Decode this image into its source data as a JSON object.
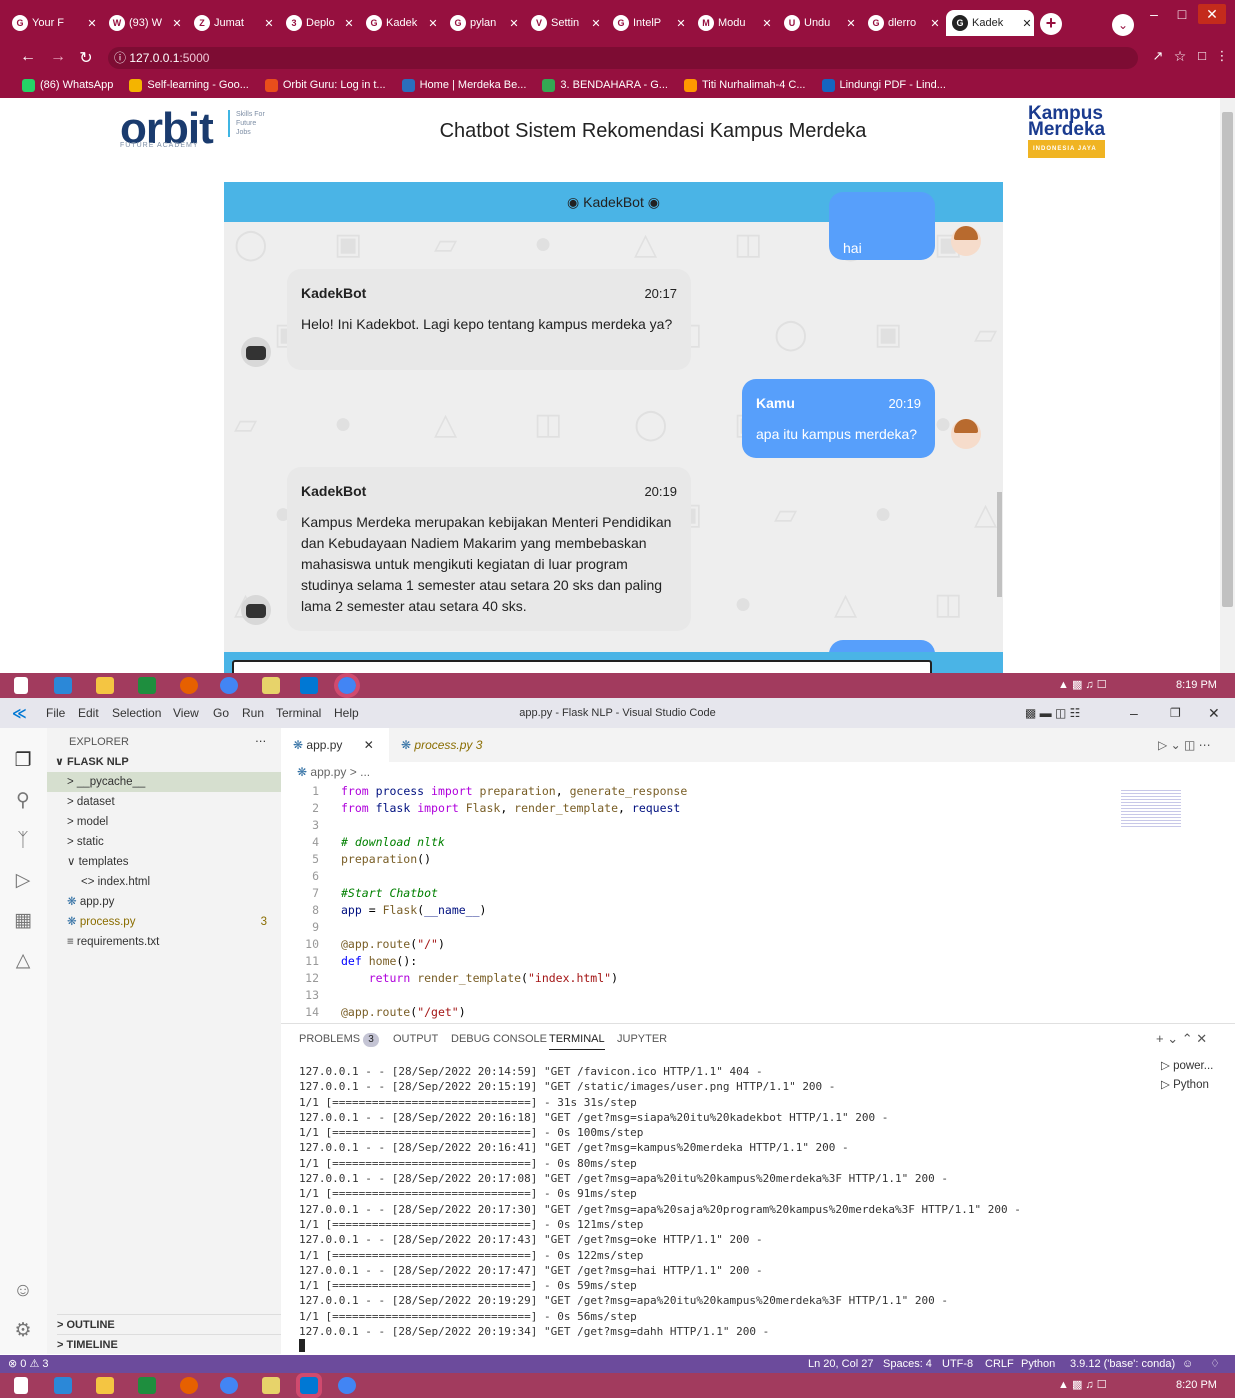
{
  "browser": {
    "tabs": [
      {
        "label": "Your F",
        "icon": "G"
      },
      {
        "label": "(93) W",
        "icon": "W"
      },
      {
        "label": "Jumat",
        "icon": "Z"
      },
      {
        "label": "Deplo",
        "icon": "3"
      },
      {
        "label": "Kadek",
        "icon": "G"
      },
      {
        "label": "pylan",
        "icon": "G"
      },
      {
        "label": "Settin",
        "icon": "V"
      },
      {
        "label": "IntelP",
        "icon": "G"
      },
      {
        "label": "Modu",
        "icon": "M"
      },
      {
        "label": "Undu",
        "icon": "U"
      },
      {
        "label": "dlerro",
        "icon": "G"
      },
      {
        "label": "Kadek",
        "icon": "G",
        "active": true
      }
    ],
    "url_host": "127.0.0.1",
    "url_port": ":5000",
    "bookmarks": [
      {
        "label": "(86) WhatsApp",
        "color": "#25d366"
      },
      {
        "label": "Self-learning - Goo...",
        "color": "#f4b400"
      },
      {
        "label": "Orbit Guru: Log in t...",
        "color": "#e94e1b"
      },
      {
        "label": "Home | Merdeka Be...",
        "color": "#2a6ebd"
      },
      {
        "label": "3. BENDAHARA - G...",
        "color": "#34a853"
      },
      {
        "label": "Titi Nurhalimah-4 C...",
        "color": "#ff9800"
      },
      {
        "label": "Lindungi PDF - Lind...",
        "color": "#1565c0"
      }
    ]
  },
  "page": {
    "orbit_logo": "orbit",
    "orbit_sub": "FUTURE ACADEMY",
    "orbit_tag": "Skills For Future Jobs",
    "title": "Chatbot Sistem Rekomendasi Kampus Merdeka",
    "km_logo_line1": "Kampus",
    "km_logo_line2": "Merdeka",
    "km_logo_band": "INDONESIA JAYA",
    "chat_header": "KadekBot",
    "messages": [
      {
        "from": "user",
        "name": "",
        "time": "",
        "text": "hai"
      },
      {
        "from": "bot",
        "name": "KadekBot",
        "time": "20:17",
        "text": "Helo! Ini Kadekbot. Lagi kepo tentang kampus merdeka ya?"
      },
      {
        "from": "user",
        "name": "Kamu",
        "time": "20:19",
        "text": "apa itu kampus merdeka?"
      },
      {
        "from": "bot",
        "name": "KadekBot",
        "time": "20:19",
        "text": "Kampus Merdeka merupakan kebijakan Menteri Pendidikan dan Kebudayaan Nadiem Makarim yang membebaskan mahasiswa untuk mengikuti kegiatan di luar program studinya selama 1 semester atau setara 20 sks dan paling lama 2 semester atau setara 40 sks."
      }
    ]
  },
  "taskbar_top": {
    "time": "8:19 PM"
  },
  "taskbar_bottom": {
    "time": "8:20 PM"
  },
  "vscode": {
    "menu": [
      "File",
      "Edit",
      "Selection",
      "View",
      "Go",
      "Run",
      "Terminal",
      "Help"
    ],
    "window_title": "app.py - Flask NLP - Visual Studio Code",
    "explorer_title": "EXPLORER",
    "project": "FLASK NLP",
    "tree": [
      {
        "label": "> __pycache__",
        "indent": 1,
        "selected": true
      },
      {
        "label": "> dataset",
        "indent": 1
      },
      {
        "label": "> model",
        "indent": 1
      },
      {
        "label": "> static",
        "indent": 1
      },
      {
        "label": "∨ templates",
        "indent": 1
      },
      {
        "label": "<> index.html",
        "indent": 2
      },
      {
        "label": "app.py",
        "indent": 1,
        "py": true
      },
      {
        "label": "process.py",
        "indent": 1,
        "py": true,
        "badge": "3"
      },
      {
        "label": "≡ requirements.txt",
        "indent": 1
      }
    ],
    "outline": "> OUTLINE",
    "timeline": "> TIMELINE",
    "tab_active": "app.py",
    "tab_other": "process.py 3",
    "breadcrumb": "app.py > ...",
    "code": [
      {
        "n": "1",
        "html": "<span class='kw2'>from</span> <span class='vr'>process</span> <span class='kw2'>import</span> <span class='fn'>preparation</span>, <span class='fn'>generate_response</span>"
      },
      {
        "n": "2",
        "html": "<span class='kw2'>from</span> <span class='vr'>flask</span> <span class='kw2'>import</span> <span class='fn'>Flask</span>, <span class='fn'>render_template</span>, <span class='vr'>request</span>"
      },
      {
        "n": "3",
        "html": ""
      },
      {
        "n": "4",
        "html": "<span class='cm'># download nltk</span>"
      },
      {
        "n": "5",
        "html": "<span class='fn'>preparation</span>()"
      },
      {
        "n": "6",
        "html": ""
      },
      {
        "n": "7",
        "html": "<span class='cm'>#Start Chatbot</span>"
      },
      {
        "n": "8",
        "html": "<span class='vr'>app</span> = <span class='fn'>Flask</span>(<span class='vr'>__name__</span>)"
      },
      {
        "n": "9",
        "html": ""
      },
      {
        "n": "10",
        "html": "<span class='dc'>@app.route</span>(<span class='st'>\"/\"</span>)"
      },
      {
        "n": "11",
        "html": "<span class='kw'>def</span> <span class='fn'>home</span>():"
      },
      {
        "n": "12",
        "html": "    <span class='kw2'>return</span> <span class='fn'>render_template</span>(<span class='st'>\"index.html\"</span>)"
      },
      {
        "n": "13",
        "html": ""
      },
      {
        "n": "14",
        "html": "<span class='dc'>@app.route</span>(<span class='st'>\"/get\"</span>)"
      }
    ],
    "panel_tabs": [
      "PROBLEMS",
      "OUTPUT",
      "DEBUG CONSOLE",
      "TERMINAL",
      "JUPYTER"
    ],
    "problems_count": "3",
    "terminals": [
      "power...",
      "Python"
    ],
    "terminal_lines": [
      "127.0.0.1 - - [28/Sep/2022 20:14:59] \"GET /favicon.ico HTTP/1.1\" 404 -",
      "127.0.0.1 - - [28/Sep/2022 20:15:19] \"GET /static/images/user.png HTTP/1.1\" 200 -",
      "1/1 [==============================] - 31s 31s/step",
      "127.0.0.1 - - [28/Sep/2022 20:16:18] \"GET /get?msg=siapa%20itu%20kadekbot HTTP/1.1\" 200 -",
      "1/1 [==============================] - 0s 100ms/step",
      "127.0.0.1 - - [28/Sep/2022 20:16:41] \"GET /get?msg=kampus%20merdeka HTTP/1.1\" 200 -",
      "1/1 [==============================] - 0s 80ms/step",
      "127.0.0.1 - - [28/Sep/2022 20:17:08] \"GET /get?msg=apa%20itu%20kampus%20merdeka%3F HTTP/1.1\" 200 -",
      "1/1 [==============================] - 0s 91ms/step",
      "127.0.0.1 - - [28/Sep/2022 20:17:30] \"GET /get?msg=apa%20saja%20program%20kampus%20merdeka%3F HTTP/1.1\" 200 -",
      "1/1 [==============================] - 0s 121ms/step",
      "127.0.0.1 - - [28/Sep/2022 20:17:43] \"GET /get?msg=oke HTTP/1.1\" 200 -",
      "1/1 [==============================] - 0s 122ms/step",
      "127.0.0.1 - - [28/Sep/2022 20:17:47] \"GET /get?msg=hai HTTP/1.1\" 200 -",
      "1/1 [==============================] - 0s 59ms/step",
      "127.0.0.1 - - [28/Sep/2022 20:19:29] \"GET /get?msg=apa%20itu%20kampus%20merdeka%3F HTTP/1.1\" 200 -",
      "1/1 [==============================] - 0s 56ms/step",
      "127.0.0.1 - - [28/Sep/2022 20:19:34] \"GET /get?msg=dahh HTTP/1.1\" 200 -"
    ],
    "status": {
      "errors": "⊗ 0 ⚠ 3",
      "position": "Ln 20, Col 27",
      "spaces": "Spaces: 4",
      "encoding": "UTF-8",
      "eol": "CRLF",
      "language": "Python",
      "interpreter": "3.9.12 ('base': conda)"
    }
  }
}
